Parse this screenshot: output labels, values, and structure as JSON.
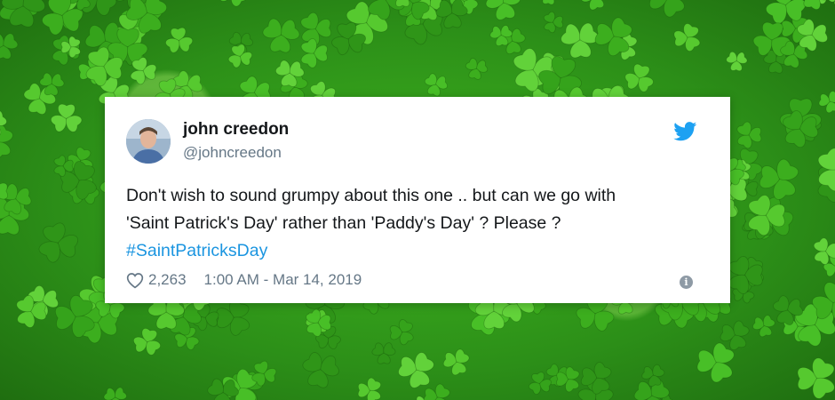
{
  "tweet": {
    "author_name": "john creedon",
    "author_handle": "@johncreedon",
    "text_line1": "Don't wish to sound grumpy about this one .. but can we go with",
    "text_line2": "'Saint Patrick's Day' rather than 'Paddy's Day' ? Please ?",
    "hashtag": "#SaintPatricksDay",
    "likes": "2,263",
    "timestamp": "1:00 AM - Mar 14, 2019",
    "info_glyph": "i"
  },
  "icons": {
    "brand": "twitter-bird-icon",
    "like": "heart-icon",
    "info": "info-icon"
  },
  "colors": {
    "twitter_blue": "#1da1f2",
    "hashtag": "#1b95e0",
    "muted_text": "#657786",
    "background_green": "#2f9a1c"
  }
}
